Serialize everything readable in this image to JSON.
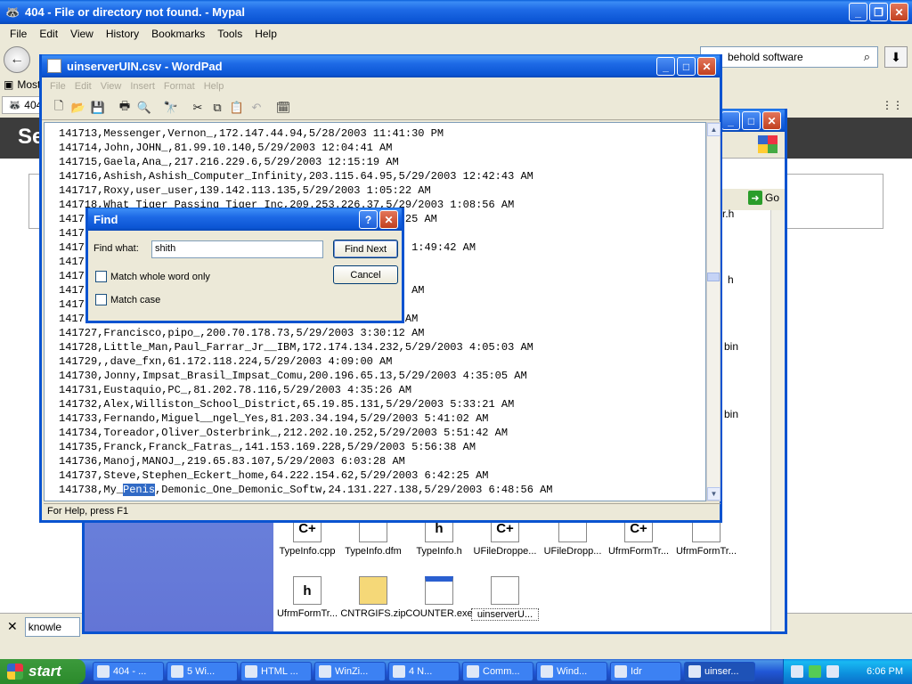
{
  "browser": {
    "title": "404 - File or directory not found. - Mypal",
    "menu": [
      "File",
      "Edit",
      "View",
      "History",
      "Bookmarks",
      "Tools",
      "Help"
    ],
    "search_value": "behold software",
    "bookmark_label": "Most",
    "tab_label": "404",
    "page_heading": "Se",
    "find_value": "knowle"
  },
  "explorer": {
    "go_label": "Go",
    "side_fragments": [
      "r.h",
      "h",
      "bin",
      "bin"
    ],
    "files_row1": [
      "TypeInfo.cpp",
      "TypeInfo.dfm",
      "TypeInfo.h",
      "UFileDroppe...",
      "UFileDropp...",
      "UfrmFormTr...",
      "UfrmFormTr..."
    ],
    "files_row1_glyph": [
      "C+",
      "",
      "h",
      "C+",
      "",
      "C+",
      ""
    ],
    "files_row2": [
      "UfrmFormTr...",
      "CNTRGIFS.zip",
      "COUNTER.exe",
      "uinserverU..."
    ],
    "files_row2_glyph": [
      "h",
      "",
      "",
      ""
    ]
  },
  "wordpad": {
    "title": "uinserverUIN.csv - WordPad",
    "menu": [
      "File",
      "Edit",
      "View",
      "Insert",
      "Format",
      "Help"
    ],
    "status": "For Help, press F1",
    "lines": [
      "141713,Messenger,Vernon_,172.147.44.94,5/28/2003 11:41:30 PM",
      "141714,John,JOHN_,81.99.10.140,5/29/2003 12:04:41 AM",
      "141715,Gaela,Ana_,217.216.229.6,5/29/2003 12:15:19 AM",
      "141716,Ashish,Ashish_Computer_Infinity,203.115.64.95,5/29/2003 12:42:43 AM",
      "141717,Roxy,user_user,139.142.113.135,5/29/2003 1:05:22 AM",
      "141718,What_Tiger_Passing_Tiger_Inc,209.253.226.37,5/29/2003 1:08:56 AM",
      "1417                                        2003 1:19:25 AM",
      "1417",
      "1417                                      47,5/29/2003 1:49:42 AM",
      "1417                                      09:58 AM",
      "1417                                      03 AM",
      "1417                                      2003 3:08:37 AM",
      "1417                                      :09:24 AM",
      "1417                                      003 3:28:17 AM",
      "141727,Francisco,pipo_,200.70.178.73,5/29/2003 3:30:12 AM",
      "141728,Little_Man,Paul_Farrar_Jr__IBM,172.174.134.232,5/29/2003 4:05:03 AM",
      "141729,,dave_fxn,61.172.118.224,5/29/2003 4:09:00 AM",
      "141730,Jonny,Impsat_Brasil_Impsat_Comu,200.196.65.13,5/29/2003 4:35:05 AM",
      "141731,Eustaquio,PC_,81.202.78.116,5/29/2003 4:35:26 AM",
      "141732,Alex,Williston_School_District,65.19.85.131,5/29/2003 5:33:21 AM",
      "141733,Fernando,Miguel__ngel_Yes,81.203.34.194,5/29/2003 5:41:02 AM",
      "141734,Toreador,Oliver_Osterbrink_,212.202.10.252,5/29/2003 5:51:42 AM",
      "141735,Franck,Franck_Fatras_,141.153.169.228,5/29/2003 5:56:38 AM",
      "141736,Manoj,MANOJ_,219.65.83.107,5/29/2003 6:03:28 AM",
      "141737,Steve,Stephen_Eckert_home,64.222.154.62,5/29/2003 6:42:25 AM"
    ],
    "last_line_prefix": "141738,My_",
    "last_line_highlight": "Penis",
    "last_line_suffix": ",Demonic_One_Demonic_Softw,24.131.227.138,5/29/2003 6:48:56 AM"
  },
  "find_dialog": {
    "title": "Find",
    "find_what_label": "Find what:",
    "find_what_value": "shith",
    "find_next": "Find Next",
    "cancel": "Cancel",
    "match_whole_word": "Match whole word only",
    "match_case": "Match case",
    "help_btn": "?",
    "close_btn": "✕"
  },
  "taskbar": {
    "start": "start",
    "tasks": [
      "404 - ...",
      "5 Wi...",
      "HTML ...",
      "WinZi...",
      "4 N...",
      "Comm...",
      "Wind...",
      "Idr",
      "uinser..."
    ],
    "clock": "6:06 PM"
  }
}
